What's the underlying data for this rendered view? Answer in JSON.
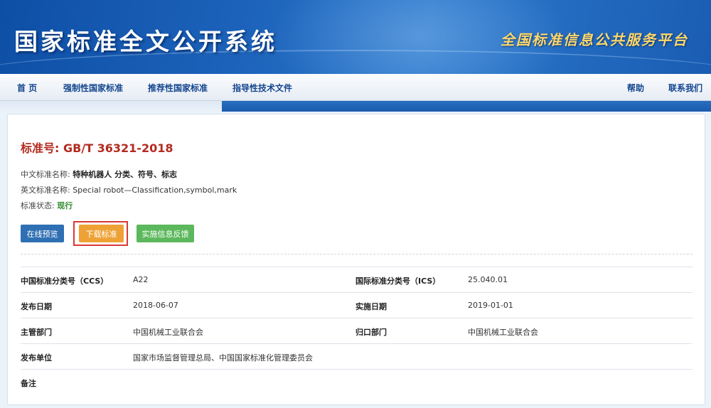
{
  "banner": {
    "title": "国家标准全文公开系统",
    "subtitle": "全国标准信息公共服务平台"
  },
  "nav": {
    "left": [
      "首 页",
      "强制性国家标准",
      "推荐性国家标准",
      "指导性技术文件"
    ],
    "right": [
      "帮助",
      "联系我们"
    ]
  },
  "standard": {
    "number_label": "标准号: ",
    "number": "GB/T 36321-2018",
    "cn_name_label": "中文标准名称: ",
    "cn_name": "特种机器人 分类、符号、标志",
    "en_name_label": "英文标准名称: ",
    "en_name": "Special robot—Classification,symbol,mark",
    "status_label": "标准状态: ",
    "status": "现行"
  },
  "actions": {
    "preview": "在线预览",
    "download": "下载标准",
    "feedback": "实施信息反馈"
  },
  "details": {
    "rows": [
      {
        "k1": "中国标准分类号（CCS）",
        "v1": "A22",
        "k2": "国际标准分类号（ICS）",
        "v2": "25.040.01"
      },
      {
        "k1": "发布日期",
        "v1": "2018-06-07",
        "k2": "实施日期",
        "v2": "2019-01-01"
      },
      {
        "k1": "主管部门",
        "v1": "中国机械工业联合会",
        "k2": "归口部门",
        "v2": "中国机械工业联合会"
      },
      {
        "k1": "发布单位",
        "v1": "国家市场监督管理总局、中国国家标准化管理委员会",
        "k2": "",
        "v2": ""
      },
      {
        "k1": "备注",
        "v1": "",
        "k2": "",
        "v2": ""
      }
    ]
  },
  "colors": {
    "brand_blue": "#1d63bb",
    "title_red": "#b22a1f",
    "status_green": "#2f8a2f",
    "highlight_red": "#d83a34"
  }
}
